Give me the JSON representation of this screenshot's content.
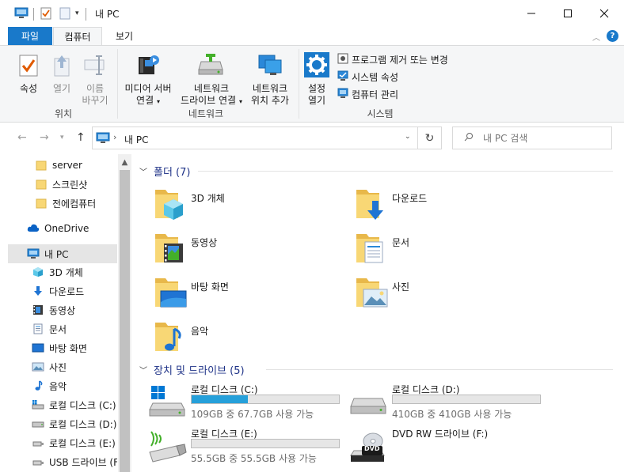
{
  "window": {
    "title": "내 PC",
    "minimize": "—",
    "maximize": "☐",
    "close": "✕"
  },
  "ribbon_tabs": {
    "file": "파일",
    "computer": "컴퓨터",
    "view": "보기"
  },
  "ribbon": {
    "location": {
      "label": "위치",
      "properties": "속성",
      "open": "열기",
      "rename_l1": "이름",
      "rename_l2": "바꾸기"
    },
    "network": {
      "label": "네트워크",
      "media_l1": "미디어 서버",
      "media_l2": "연결",
      "map_l1": "네트워크",
      "map_l2": "드라이브 연결",
      "add_l1": "네트워크",
      "add_l2": "위치 추가"
    },
    "system": {
      "label": "시스템",
      "settings_l1": "설정",
      "settings_l2": "열기",
      "uninstall": "프로그램 제거 또는 변경",
      "sys_props": "시스템 속성",
      "manage": "컴퓨터 관리"
    }
  },
  "address": {
    "path": "내 PC",
    "search_placeholder": "내 PC 검색"
  },
  "nav": {
    "items": [
      {
        "label": "server",
        "icon": "folder-icon"
      },
      {
        "label": "스크린샷",
        "icon": "folder-icon"
      },
      {
        "label": "전에컴퓨터",
        "icon": "folder-icon"
      },
      {
        "label": "OneDrive",
        "icon": "cloud-icon"
      },
      {
        "label": "내 PC",
        "icon": "pc-icon"
      },
      {
        "label": "3D 개체",
        "icon": "cube-icon"
      },
      {
        "label": "다운로드",
        "icon": "download-icon"
      },
      {
        "label": "동영상",
        "icon": "video-icon"
      },
      {
        "label": "문서",
        "icon": "document-icon"
      },
      {
        "label": "바탕 화면",
        "icon": "desktop-icon"
      },
      {
        "label": "사진",
        "icon": "picture-icon"
      },
      {
        "label": "음악",
        "icon": "music-icon"
      },
      {
        "label": "로컬 디스크 (C:)",
        "icon": "drive-c-icon"
      },
      {
        "label": "로컬 디스크 (D:)",
        "icon": "drive-icon"
      },
      {
        "label": "로컬 디스크 (E:)",
        "icon": "usb-icon"
      },
      {
        "label": "USB 드라이브 (F:)",
        "icon": "usb-icon"
      }
    ]
  },
  "folders": {
    "header": "폴더 (7)",
    "items": [
      {
        "label": "3D 개체"
      },
      {
        "label": "다운로드"
      },
      {
        "label": "동영상"
      },
      {
        "label": "문서"
      },
      {
        "label": "바탕 화면"
      },
      {
        "label": "사진"
      },
      {
        "label": "음악"
      }
    ]
  },
  "devices": {
    "header": "장치 및 드라이브 (5)",
    "items": [
      {
        "name": "로컬 디스크 (C:)",
        "info": "109GB 중 67.7GB 사용 가능",
        "used_fraction": 0.38
      },
      {
        "name": "로컬 디스크 (D:)",
        "info": "410GB 중 410GB 사용 가능",
        "used_fraction": 0.0
      },
      {
        "name": "로컬 디스크 (E:)",
        "info": "55.5GB 중 55.5GB 사용 가능",
        "used_fraction": 0.0
      },
      {
        "name": "DVD RW 드라이브 (F:)"
      }
    ]
  },
  "colors": {
    "accent": "#1979ca",
    "folder": "#f8d775",
    "bar_fill": "#26a0da"
  }
}
